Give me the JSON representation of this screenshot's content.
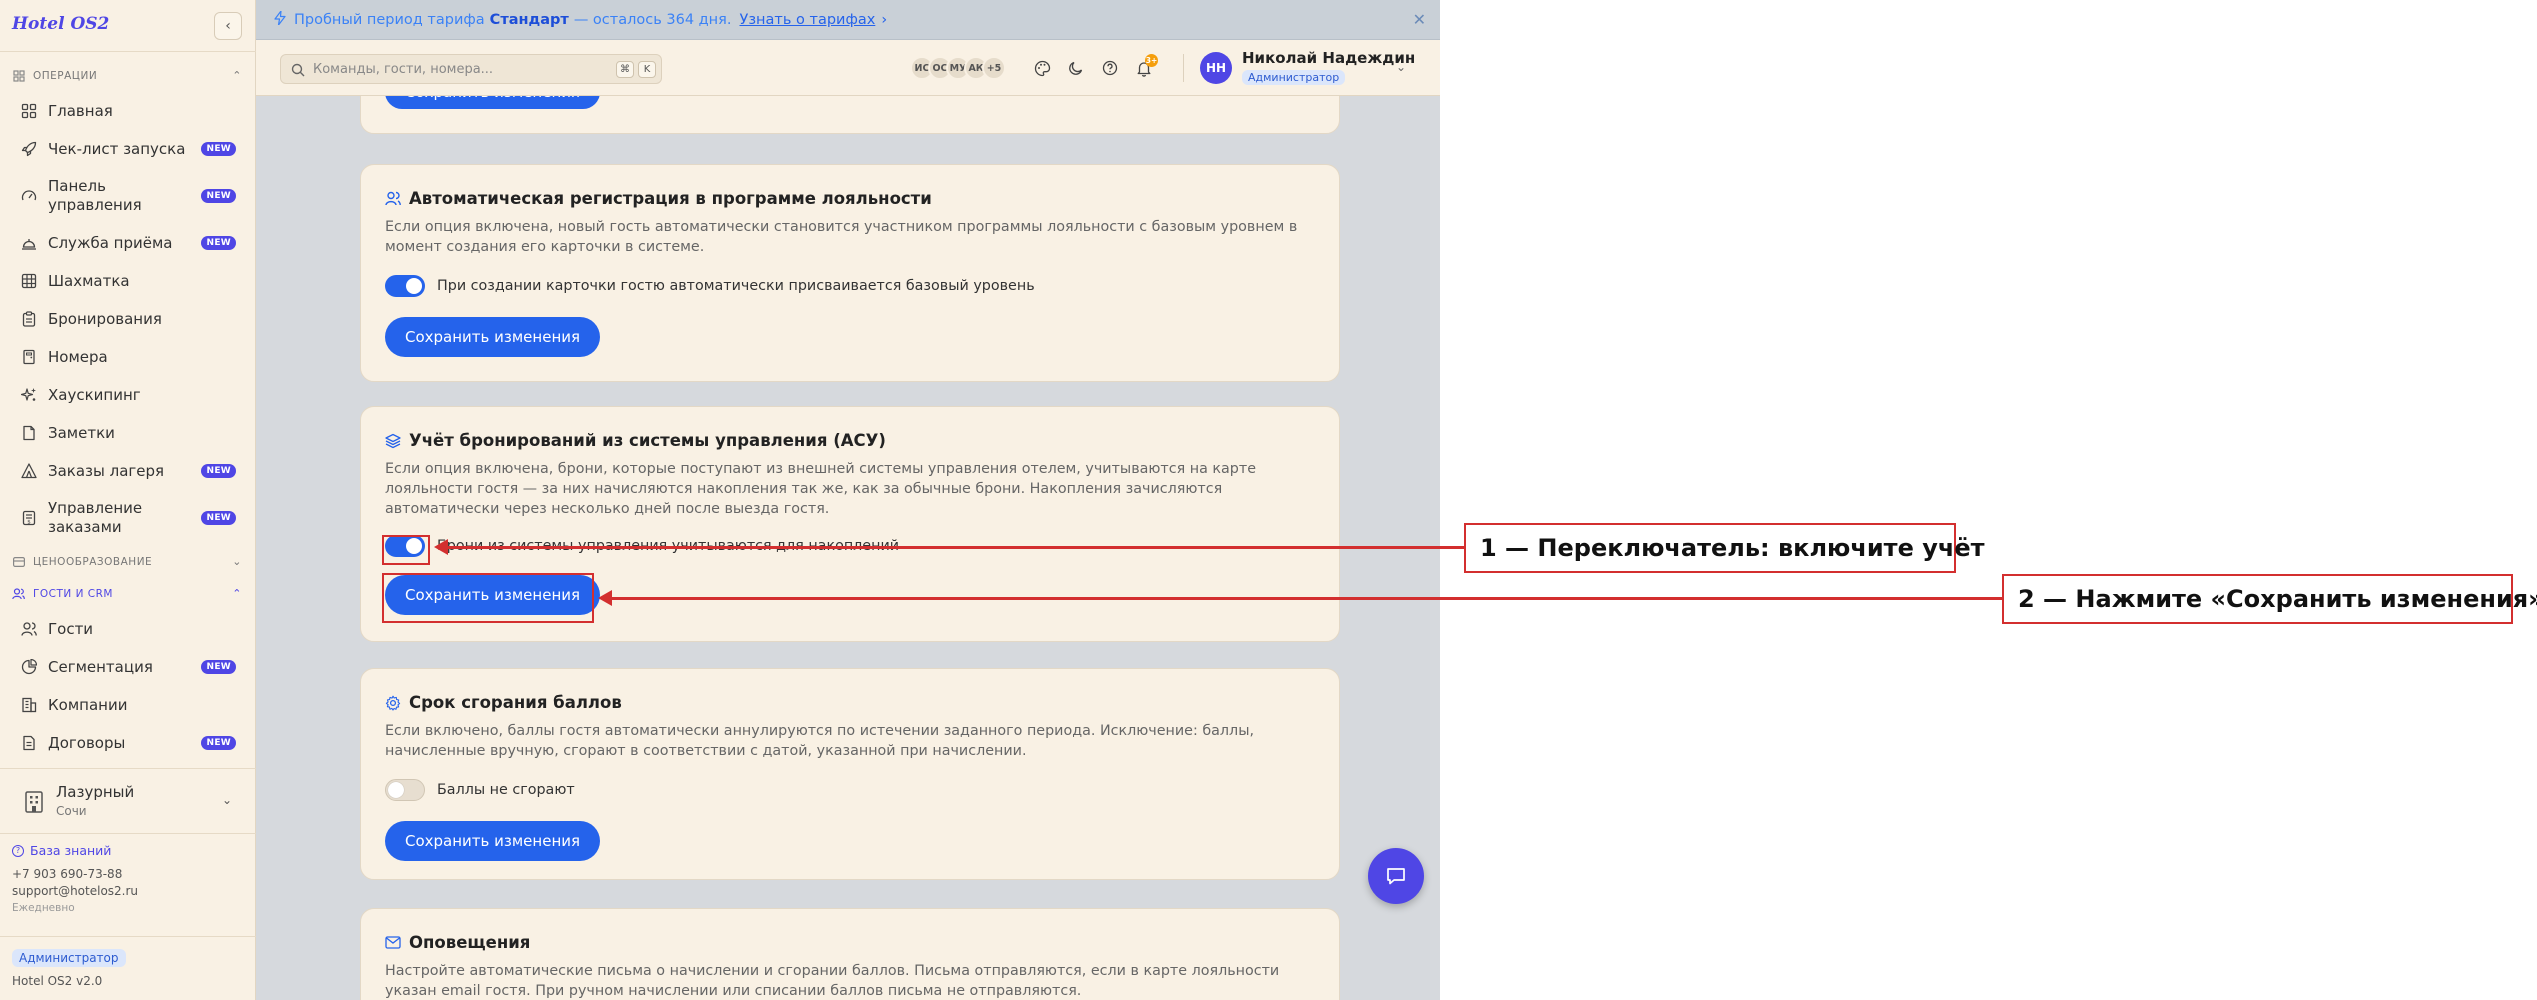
{
  "app": {
    "logo": "Hotel OS2"
  },
  "banner": {
    "prefix": "Пробный период тарифа",
    "plan": "Стандарт",
    "suffix": "— осталось 364 дня.",
    "link": "Узнать о тарифах"
  },
  "header": {
    "search_placeholder": "Команды, гости, номера...",
    "kbd_keys": [
      "⌘",
      "K"
    ],
    "avatars": [
      "ИС",
      "ОС",
      "МУ",
      "АК",
      "+5"
    ],
    "notification_count": "3+",
    "user_initials": "НН",
    "user_name": "Николай Надеждин",
    "user_role": "Администратор"
  },
  "sidebar": {
    "sections": {
      "operations": "Операции",
      "pricing": "Ценообразование",
      "guests": "Гости и CRM"
    },
    "operations_items": [
      {
        "label": "Главная",
        "icon": "grid-icon",
        "badge": ""
      },
      {
        "label": "Чек-лист запуска",
        "icon": "rocket-icon",
        "badge": "NEW"
      },
      {
        "label": "Панель управления",
        "icon": "gauge-icon",
        "badge": "NEW"
      },
      {
        "label": "Служба приёма",
        "icon": "bell-desk-icon",
        "badge": "NEW"
      },
      {
        "label": "Шахматка",
        "icon": "table-icon",
        "badge": ""
      },
      {
        "label": "Бронирования",
        "icon": "clipboard-icon",
        "badge": ""
      },
      {
        "label": "Номера",
        "icon": "door-icon",
        "badge": ""
      },
      {
        "label": "Хаускипинг",
        "icon": "sparkles-icon",
        "badge": ""
      },
      {
        "label": "Заметки",
        "icon": "note-icon",
        "badge": ""
      },
      {
        "label": "Заказы лагеря",
        "icon": "tent-icon",
        "badge": "NEW"
      },
      {
        "label": "Управление заказами",
        "icon": "order-icon",
        "badge": "NEW"
      }
    ],
    "guests_items": [
      {
        "label": "Гости",
        "icon": "users-icon",
        "badge": ""
      },
      {
        "label": "Сегментация",
        "icon": "pie-icon",
        "badge": "NEW"
      },
      {
        "label": "Компании",
        "icon": "building-icon",
        "badge": ""
      },
      {
        "label": "Договоры",
        "icon": "document-icon",
        "badge": "NEW"
      }
    ],
    "hotel": {
      "name": "Лазурный",
      "city": "Сочи"
    },
    "support": {
      "kb": "База знаний",
      "phone": "+7 903 690-73-88",
      "email": "support@hotelos2.ru",
      "hours": "Ежедневно"
    },
    "footer": {
      "role": "Администратор",
      "version": "Hotel OS2 v2.0"
    }
  },
  "main": {
    "top_button": "Сохранить изменения",
    "cards": [
      {
        "title": "Автоматическая регистрация в программе лояльности",
        "desc": "Если опция включена, новый гость автоматически становится участником программы лояльности с базовым уровнем в момент создания его карточки в системе.",
        "toggle_label": "При создании карточки гостю автоматически присваивается базовый уровень",
        "toggle_on": true,
        "button": "Сохранить изменения"
      },
      {
        "title": "Учёт бронирований из системы управления (АСУ)",
        "desc": "Если опция включена, брони, которые поступают из внешней системы управления отелем, учитываются на карте лояльности гостя — за них начисляются накопления так же, как за обычные брони. Накопления зачисляются автоматически через несколько дней после выезда гостя.",
        "toggle_label": "Брони из системы управления учитываются для накоплений",
        "toggle_on": true,
        "button": "Сохранить изменения"
      },
      {
        "title": "Срок сгорания баллов",
        "desc": "Если включено, баллы гостя автоматически аннулируются по истечении заданного периода. Исключение: баллы, начисленные вручную, сгорают в соответствии с датой, указанной при начислении.",
        "toggle_label": "Баллы не сгорают",
        "toggle_on": false,
        "button": "Сохранить изменения"
      },
      {
        "title": "Оповещения",
        "desc": "Настройте автоматические письма о начислении и сгорании баллов. Письма отправляются, если в карте лояльности указан email гостя. При ручном начислении или списании баллов письма не отправляются."
      }
    ]
  },
  "annotations": {
    "step1": "1 — Переключатель: включите учёт",
    "step2": "2 — Нажмите «Сохранить изменения»",
    "color": "#d32f2f"
  },
  "colors": {
    "accent": "#2563eb",
    "brand": "#4f46e5",
    "panel": "#f9f1e4"
  }
}
